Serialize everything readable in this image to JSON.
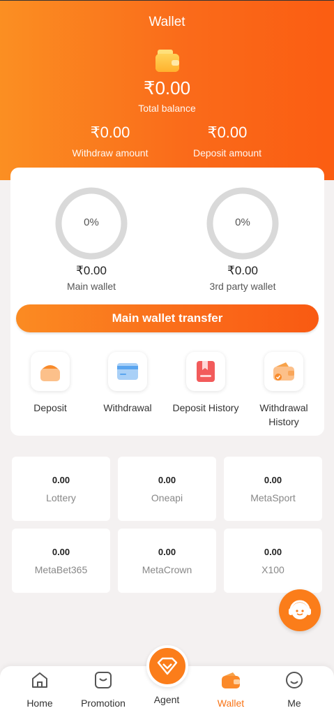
{
  "header": {
    "title": "Wallet",
    "total_amount": "₹0.00",
    "total_label": "Total balance",
    "withdraw_amount": "₹0.00",
    "withdraw_label": "Withdraw amount",
    "deposit_amount": "₹0.00",
    "deposit_label": "Deposit amount"
  },
  "wallets": {
    "main": {
      "percent": "0%",
      "amount": "₹0.00",
      "label": "Main wallet"
    },
    "third_party": {
      "percent": "0%",
      "amount": "₹0.00",
      "label": "3rd party wallet"
    }
  },
  "transfer_button": "Main wallet transfer",
  "actions": [
    {
      "label": "Deposit",
      "icon": "deposit-icon"
    },
    {
      "label": "Withdrawal",
      "icon": "withdrawal-card-icon"
    },
    {
      "label": "Deposit History",
      "icon": "deposit-history-icon"
    },
    {
      "label": "Withdrawal History",
      "icon": "withdrawal-history-icon"
    }
  ],
  "games": [
    {
      "value": "0.00",
      "name": "Lottery"
    },
    {
      "value": "0.00",
      "name": "Oneapi"
    },
    {
      "value": "0.00",
      "name": "MetaSport"
    },
    {
      "value": "0.00",
      "name": "MetaBet365"
    },
    {
      "value": "0.00",
      "name": "MetaCrown"
    },
    {
      "value": "0.00",
      "name": "X100"
    }
  ],
  "nav": [
    {
      "label": "Home",
      "icon": "home-icon"
    },
    {
      "label": "Promotion",
      "icon": "promotion-icon"
    },
    {
      "label": "Agent",
      "icon": "agent-diamond-icon"
    },
    {
      "label": "Wallet",
      "icon": "wallet-icon",
      "active": true
    },
    {
      "label": "Me",
      "icon": "profile-icon"
    }
  ],
  "colors": {
    "accent": "#fa6b1a",
    "accent_light": "#fb8f22",
    "ring": "#d9d9d9",
    "active_nav": "#f87315"
  }
}
